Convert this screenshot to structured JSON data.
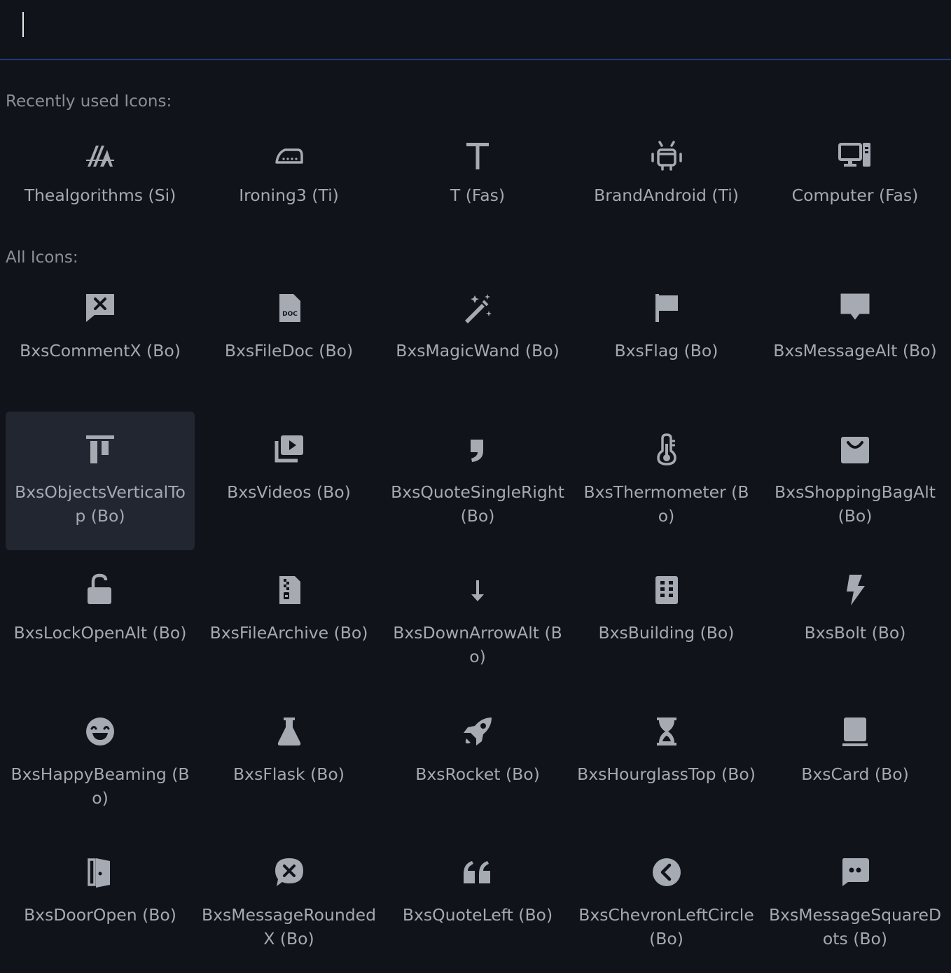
{
  "search": {
    "value": "",
    "placeholder": ""
  },
  "recent": {
    "heading": "Recently used Icons:",
    "items": [
      {
        "label": "Thealgorithms (Si)",
        "icon": "thealgorithms-icon"
      },
      {
        "label": "Ironing3 (Ti)",
        "icon": "iron-icon"
      },
      {
        "label": "T (Fas)",
        "icon": "letter-t-icon"
      },
      {
        "label": "BrandAndroid (Ti)",
        "icon": "android-icon"
      },
      {
        "label": "Computer (Fas)",
        "icon": "computer-icon"
      }
    ]
  },
  "all": {
    "heading": "All Icons:",
    "items": [
      {
        "label": "BxsCommentX (Bo)",
        "icon": "comment-x-icon"
      },
      {
        "label": "BxsFileDoc (Bo)",
        "icon": "file-doc-icon"
      },
      {
        "label": "BxsMagicWand (Bo)",
        "icon": "magic-wand-icon"
      },
      {
        "label": "BxsFlag (Bo)",
        "icon": "flag-icon"
      },
      {
        "label": "BxsMessageAlt (Bo)",
        "icon": "message-alt-icon"
      },
      {
        "label": "BxsObjectsVerticalTop (Bo)",
        "icon": "objects-vertical-top-icon",
        "selected": true
      },
      {
        "label": "BxsVideos (Bo)",
        "icon": "videos-icon"
      },
      {
        "label": "BxsQuoteSingleRight (Bo)",
        "icon": "quote-single-right-icon"
      },
      {
        "label": "BxsThermometer (Bo)",
        "icon": "thermometer-icon"
      },
      {
        "label": "BxsShoppingBagAlt (Bo)",
        "icon": "shopping-bag-icon"
      },
      {
        "label": "BxsLockOpenAlt (Bo)",
        "icon": "lock-open-icon"
      },
      {
        "label": "BxsFileArchive (Bo)",
        "icon": "file-archive-icon"
      },
      {
        "label": "BxsDownArrowAlt (Bo)",
        "icon": "down-arrow-icon"
      },
      {
        "label": "BxsBuilding (Bo)",
        "icon": "building-icon"
      },
      {
        "label": "BxsBolt (Bo)",
        "icon": "bolt-icon"
      },
      {
        "label": "BxsHappyBeaming (Bo)",
        "icon": "happy-beaming-icon"
      },
      {
        "label": "BxsFlask (Bo)",
        "icon": "flask-icon"
      },
      {
        "label": "BxsRocket (Bo)",
        "icon": "rocket-icon"
      },
      {
        "label": "BxsHourglassTop (Bo)",
        "icon": "hourglass-top-icon"
      },
      {
        "label": "BxsCard (Bo)",
        "icon": "card-icon"
      },
      {
        "label": "BxsDoorOpen (Bo)",
        "icon": "door-open-icon"
      },
      {
        "label": "BxsMessageRoundedX (Bo)",
        "icon": "message-rounded-x-icon"
      },
      {
        "label": "BxsQuoteLeft (Bo)",
        "icon": "quote-left-icon"
      },
      {
        "label": "BxsChevronLeftCircle (Bo)",
        "icon": "chevron-left-circle-icon"
      },
      {
        "label": "BxsMessageSquareDots (Bo)",
        "icon": "message-square-dots-icon"
      }
    ]
  },
  "colors": {
    "background": "#10131a",
    "text": "#a4a9b2",
    "heading": "#8a8f98",
    "selected_tile": "#222630",
    "focus_line": "#1f3a78"
  }
}
